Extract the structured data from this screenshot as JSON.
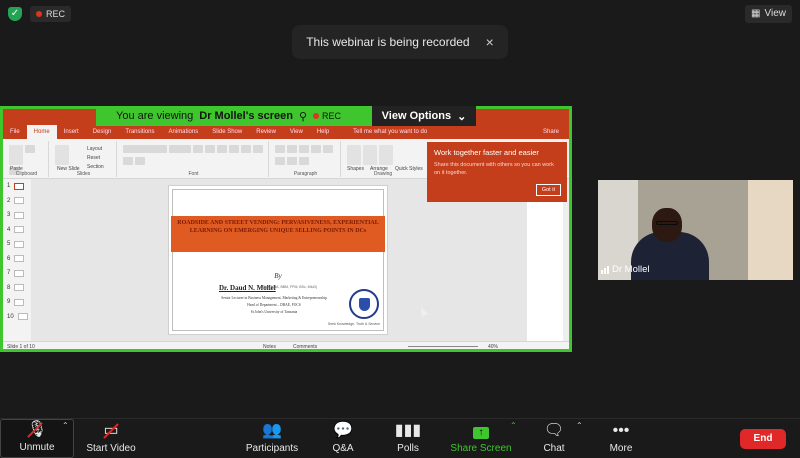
{
  "topbar": {
    "rec_label": "REC",
    "view_label": "View"
  },
  "toast": {
    "message": "This webinar is being recorded",
    "close": "×"
  },
  "share": {
    "viewing_prefix": "You are viewing",
    "presenter": "Dr Mollel's screen",
    "rec_label": "REC",
    "view_options": "View Options"
  },
  "ppt": {
    "tabs": [
      "File",
      "Home",
      "Insert",
      "Design",
      "Transitions",
      "Animations",
      "Slide Show",
      "Review",
      "View",
      "Help"
    ],
    "active_tab": "Home",
    "tell_me": "Tell me what you want to do",
    "share": "Share",
    "ribbon_groups": [
      "Clipboard",
      "Slides",
      "Font",
      "Paragraph",
      "Drawing"
    ],
    "ribbon_slide_buttons": [
      "New Slide",
      "Layout",
      "Reset",
      "Section"
    ],
    "ribbon_drawing_buttons": [
      "Shapes",
      "Arrange",
      "Quick Styles"
    ],
    "paste_label": "Paste",
    "tip_title": "Work together faster and easier",
    "tip_text": "Share this document with others so you can work on it together.",
    "tip_button": "Got it",
    "thumbnails": [
      "1",
      "2",
      "3",
      "4",
      "5",
      "6",
      "7",
      "8",
      "9",
      "10"
    ],
    "status_slide": "Slide 1 of 10",
    "status_notes": "Notes",
    "status_comments": "Comments",
    "zoom": "40%",
    "slide": {
      "title": "ROADSIDE AND STREET VENDING: PERVASIVENESS, EXPERIENTIAL LEARNING ON EMERGING UNIQUE SELLING POINTS IN DCs",
      "by": "By",
      "author": "Dr. Daud N. Mollel",
      "creds": "(PhD, MBA, BBM, FPM, BSc, MIoD)",
      "line1": "Senior Lecturer in Business Management, Marketing & Entrepreneurship",
      "line2": "Head of Department – DBAE, FOCS",
      "line3": "St John's University of Tanzania",
      "logo_caption": "Seek Knowledge, Truth & Service",
      "logo_text": "ST JOHN'S UNIVERSITY OF TANZANIA"
    }
  },
  "video": {
    "participant": "Dr Mollel"
  },
  "toolbar": {
    "unmute": "Unmute",
    "start_video": "Start Video",
    "participants": "Participants",
    "qa": "Q&A",
    "polls": "Polls",
    "share_screen": "Share Screen",
    "chat": "Chat",
    "more": "More",
    "end": "End"
  }
}
